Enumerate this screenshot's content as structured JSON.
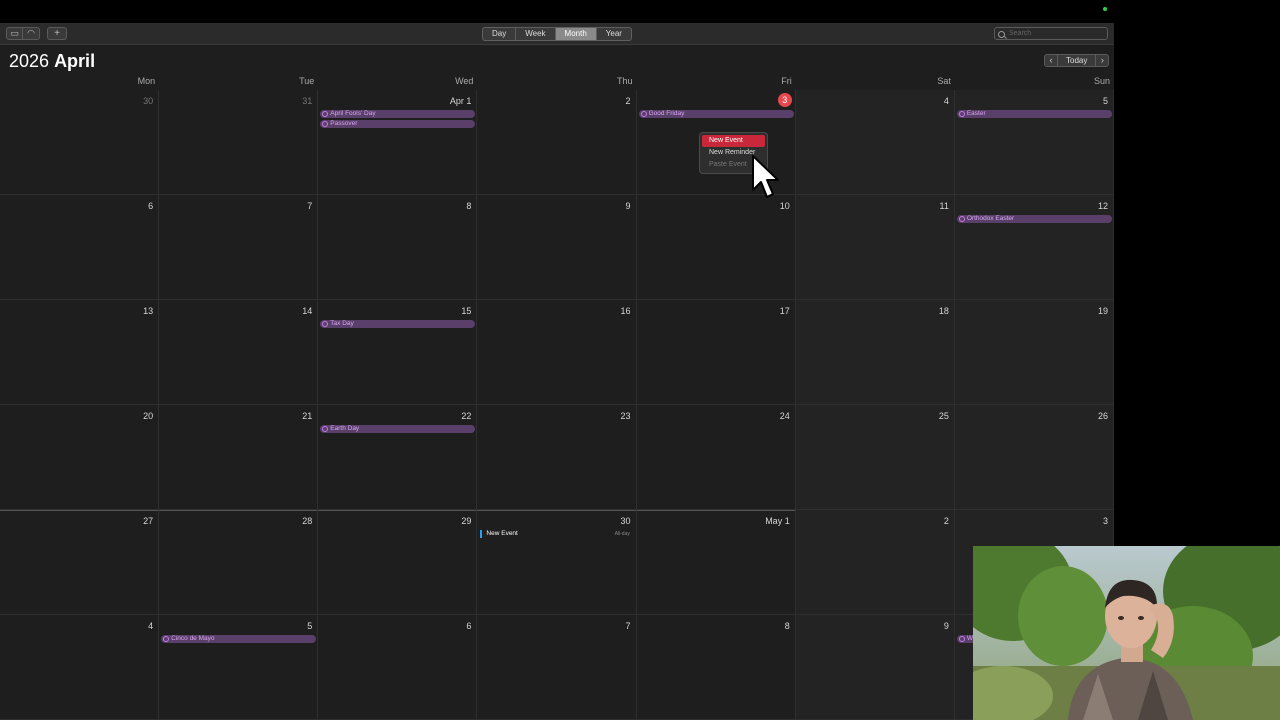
{
  "toolbar": {
    "add_label": "+",
    "views": [
      "Day",
      "Week",
      "Month",
      "Year"
    ],
    "active_view": "Month",
    "search_placeholder": "Search"
  },
  "header": {
    "year": "2026",
    "month": "April",
    "today_label": "Today",
    "prev_icon": "chevron-left-icon",
    "next_icon": "chevron-right-icon"
  },
  "weekdays": [
    "Mon",
    "Tue",
    "Wed",
    "Thu",
    "Fri",
    "Sat",
    "Sun"
  ],
  "weeks": [
    [
      "30",
      "31",
      "Apr 1",
      "2",
      "3",
      "4",
      "5"
    ],
    [
      "6",
      "7",
      "8",
      "9",
      "10",
      "11",
      "12"
    ],
    [
      "13",
      "14",
      "15",
      "16",
      "17",
      "18",
      "19"
    ],
    [
      "20",
      "21",
      "22",
      "23",
      "24",
      "25",
      "26"
    ],
    [
      "27",
      "28",
      "29",
      "30",
      "May 1",
      "2",
      "3"
    ],
    [
      "4",
      "5",
      "6",
      "7",
      "8",
      "9",
      ""
    ]
  ],
  "today": "3",
  "events": [
    {
      "title": "April Fools' Day",
      "week": 0,
      "day": 2
    },
    {
      "title": "Passover",
      "week": 0,
      "day": 2
    },
    {
      "title": "Good Friday",
      "week": 0,
      "day": 4
    },
    {
      "title": "Easter",
      "week": 0,
      "day": 6
    },
    {
      "title": "Orthodox Easter",
      "week": 1,
      "day": 6
    },
    {
      "title": "Tax Day",
      "week": 2,
      "day": 2
    },
    {
      "title": "Earth Day",
      "week": 3,
      "day": 2
    },
    {
      "title": "Cinco de Mayo",
      "week": 5,
      "day": 1
    },
    {
      "title": "W",
      "week": 5,
      "day": 6
    }
  ],
  "timed_event": {
    "title": "New Event",
    "time": "All-day"
  },
  "context_menu": {
    "items": [
      "New Event",
      "New Reminder",
      "Paste Event"
    ]
  },
  "colors": {
    "accent": "#e5484d",
    "holiday": "#c77be8",
    "menu_highlight": "#c8283a"
  }
}
